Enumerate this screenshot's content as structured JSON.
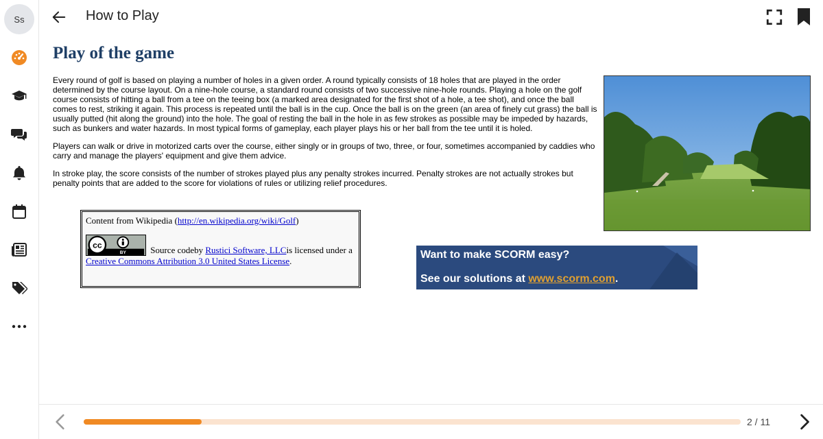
{
  "sidebar": {
    "avatar_initials": "Ss",
    "items": [
      {
        "icon": "dashboard-gauge-icon",
        "color": "#f08a24"
      },
      {
        "icon": "graduation-cap-icon"
      },
      {
        "icon": "chat-bubbles-icon"
      },
      {
        "icon": "bell-icon"
      },
      {
        "icon": "calendar-icon"
      },
      {
        "icon": "newspaper-icon"
      },
      {
        "icon": "tags-icon"
      },
      {
        "icon": "more-dots-icon"
      }
    ]
  },
  "header": {
    "title": "How to Play"
  },
  "content": {
    "heading": "Play of the game",
    "paragraphs": [
      "Every round of golf is based on playing a number of holes in a given order. A round typically consists of 18 holes that are played in the order determined by the course layout. On a nine-hole course, a standard round consists of two successive nine-hole rounds. Playing a hole on the golf course consists of hitting a ball from a tee on the teeing box (a marked area designated for the first shot of a hole, a tee shot), and once the ball comes to rest, striking it again. This process is repeated until the ball is in the cup. Once the ball is on the green (an area of finely cut grass) the ball is usually putted (hit along the ground) into the hole. The goal of resting the ball in the hole in as few strokes as possible may be impeded by hazards, such as bunkers and water hazards. In most typical forms of gameplay, each player plays his or her ball from the tee until it is holed.",
      "Players can walk or drive in motorized carts over the course, either singly or in groups of two, three, or four, sometimes accompanied by caddies who carry and manage the players' equipment and give them advice.",
      "In stroke play, the score consists of the number of strokes played plus any penalty strokes incurred. Penalty strokes are not actually strokes but penalty points that are added to the score for violations of rules or utilizing relief procedures."
    ],
    "license": {
      "source_prefix": "Content from Wikipedia (",
      "source_link": "http://en.wikipedia.org/wiki/Golf",
      "source_suffix": ")",
      "cc_badge_text": "BY",
      "code_text": " Source codeby ",
      "author_link": "Rustici Software, LLC",
      "licensed_text": "is licensed under a",
      "license_link": "Creative Commons Attribution 3.0 United States License",
      "period": "."
    },
    "banner": {
      "line1": "Want to make SCORM easy?",
      "line2_prefix": "See our solutions at ",
      "link": "www.scorm.com",
      "line2_suffix": "."
    }
  },
  "footer": {
    "progress_fraction": 0.18,
    "page_count": "2 / 11",
    "accent": "#f08a24"
  }
}
